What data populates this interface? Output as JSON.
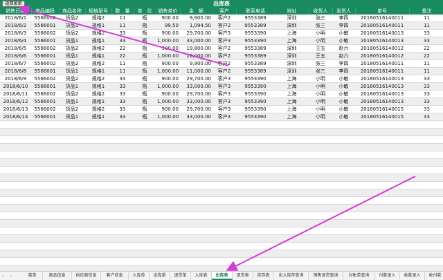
{
  "title": "出库表",
  "back_button": "返回菜单",
  "columns": [
    "销售日期",
    "商品编码",
    "商品名称",
    "规格型号",
    "数　量",
    "单　位",
    "销售单价",
    "金　额",
    "客户",
    "联系电话",
    "地址",
    "收货人",
    "发货人",
    "单号",
    "备注",
    "是否开票"
  ],
  "rows": [
    [
      "2018/6/1",
      "5566002",
      "货品2",
      "规格2",
      "11",
      "瓶",
      "900.00",
      "9,900.00",
      "客户2",
      "9553389",
      "深圳",
      "张三",
      "李四",
      "20180516140011",
      "11",
      "是"
    ],
    [
      "2018/6/2",
      "5566001",
      "货品1",
      "规格1",
      "11",
      "瓶",
      "99.50",
      "1,094.50",
      "客户2",
      "9553389",
      "深圳",
      "张三",
      "李四",
      "20180516140011",
      "11",
      "是"
    ],
    [
      "2018/6/3",
      "5566002",
      "货品2",
      "规格2",
      "33",
      "瓶",
      "900.00",
      "29,700.00",
      "客户3",
      "9553390",
      "上海",
      "小明",
      "小敏",
      "20180516140013",
      "33",
      "是"
    ],
    [
      "2018/6/4",
      "5566001",
      "货品1",
      "规格1",
      "33",
      "瓶",
      "1,000.00",
      "33,000.00",
      "客户3",
      "9553390",
      "上海",
      "小明",
      "小敏",
      "20180516140013",
      "33",
      "是"
    ],
    [
      "2018/6/5",
      "5566002",
      "货品2",
      "规格2",
      "22",
      "瓶",
      "900.00",
      "19,800.00",
      "客户2",
      "9553389",
      "深圳",
      "王五",
      "赵六",
      "20180516140012",
      "22",
      "是"
    ],
    [
      "2018/6/6",
      "5566001",
      "货品1",
      "规格1",
      "22",
      "瓶",
      "1,000.00",
      "22,000.00",
      "客户2",
      "9553389",
      "深圳",
      "王五",
      "赵六",
      "20180516140012",
      "22",
      "是"
    ],
    [
      "2018/6/7",
      "5566002",
      "货品2",
      "规格2",
      "11",
      "瓶",
      "900.00",
      "9,900.00",
      "客户2",
      "9553389",
      "深圳",
      "张三",
      "李四",
      "20180516140011",
      "11",
      "是"
    ],
    [
      "2018/6/8",
      "5566001",
      "货品1",
      "规格1",
      "11",
      "瓶",
      "1,000.00",
      "11,000.00",
      "客户2",
      "9553389",
      "深圳",
      "张三",
      "李四",
      "20180516140011",
      "11",
      "是"
    ],
    [
      "2018/6/9",
      "5566002",
      "货品2",
      "规格2",
      "33",
      "瓶",
      "900.00",
      "29,700.00",
      "客户3",
      "9553390",
      "上海",
      "小明",
      "小敏",
      "20180516140013",
      "33",
      "是"
    ],
    [
      "2018/6/10",
      "5566001",
      "货品1",
      "规格1",
      "33",
      "瓶",
      "1,000.00",
      "33,000.00",
      "客户3",
      "9553390",
      "上海",
      "小明",
      "小敏",
      "20180516140013",
      "33",
      "是"
    ],
    [
      "2018/6/11",
      "5566002",
      "货品2",
      "规格2",
      "33",
      "瓶",
      "900.00",
      "29,700.00",
      "客户3",
      "9553390",
      "上海",
      "小明",
      "小敏",
      "20180516140013",
      "33",
      "是"
    ],
    [
      "2018/6/12",
      "5566001",
      "货品1",
      "规格1",
      "33",
      "瓶",
      "1,000.00",
      "33,000.00",
      "客户3",
      "9553390",
      "上海",
      "小明",
      "小敏",
      "20180516140013",
      "33",
      "是"
    ],
    [
      "2018/6/13",
      "5566002",
      "货品2",
      "规格2",
      "33",
      "瓶",
      "900.00",
      "29,700.00",
      "客户3",
      "9553390",
      "上海",
      "小明",
      "小敏",
      "20180516140015",
      "33",
      "是"
    ],
    [
      "2018/6/14",
      "5566001",
      "货品1",
      "规格1",
      "33",
      "瓶",
      "1,000.00",
      "33,000.00",
      "客户3",
      "9553390",
      "上海",
      "小明",
      "小敏",
      "20180516140015",
      "33",
      "是"
    ]
  ],
  "sheet_tabs": [
    "菜单",
    "商品信息",
    "供应商信息",
    "客户信息",
    "入库单",
    "出库单",
    "退货单",
    "入库表",
    "出库表",
    "退货表",
    "库存表",
    "出入库存查询",
    "销售退货查询",
    "对账单查询",
    "付款录入",
    "收款录入",
    "收付款"
  ],
  "active_tab": "出库表",
  "colors": {
    "header": "#1a8a5f",
    "annotation_arrow": "#d63ad6"
  }
}
